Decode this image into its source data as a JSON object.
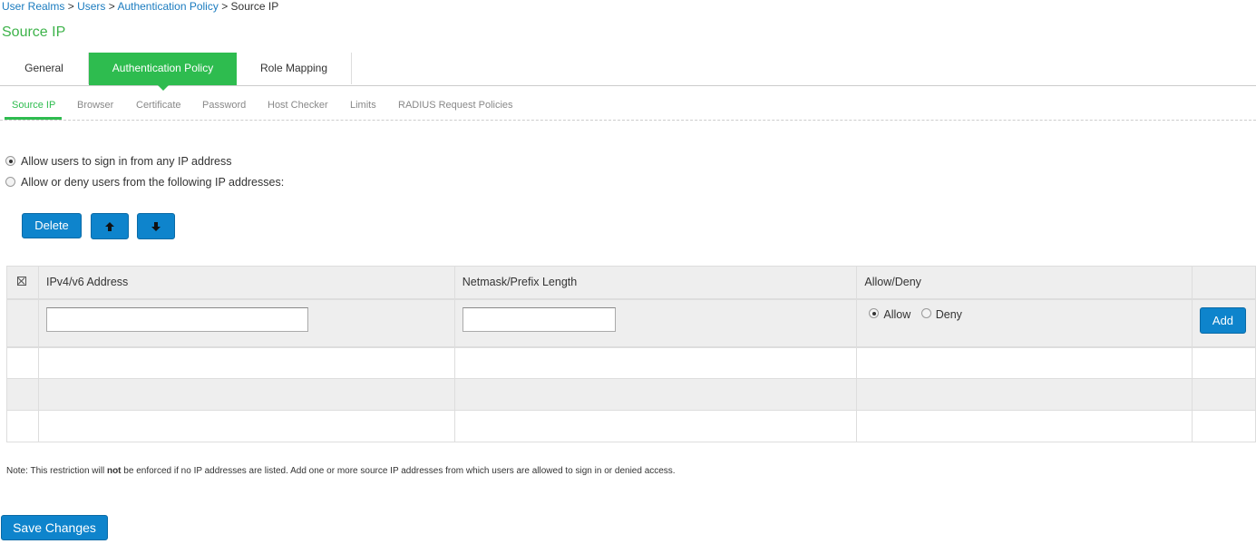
{
  "breadcrumb": {
    "items": [
      "User Realms",
      "Users",
      "Authentication Policy"
    ],
    "current": "Source IP",
    "separator": ">"
  },
  "page": {
    "title": "Source IP"
  },
  "main_tabs": [
    {
      "label": "General",
      "active": false
    },
    {
      "label": "Authentication Policy",
      "active": true
    },
    {
      "label": "Role Mapping",
      "active": false
    }
  ],
  "sub_tabs": [
    {
      "label": "Source IP",
      "active": true
    },
    {
      "label": "Browser",
      "active": false
    },
    {
      "label": "Certificate",
      "active": false
    },
    {
      "label": "Password",
      "active": false
    },
    {
      "label": "Host Checker",
      "active": false
    },
    {
      "label": "Limits",
      "active": false
    },
    {
      "label": "RADIUS Request Policies",
      "active": false
    }
  ],
  "options": {
    "any_ip": {
      "label": "Allow users to sign in from any IP address",
      "checked": true
    },
    "listed_ip": {
      "label": "Allow or deny users from the following IP addresses:",
      "checked": false
    }
  },
  "toolbar": {
    "delete_label": "Delete",
    "up_icon": "arrow-up-icon",
    "down_icon": "arrow-down-icon"
  },
  "table": {
    "columns": [
      "IPv4/v6 Address",
      "Netmask/Prefix Length",
      "Allow/Deny"
    ],
    "input_row": {
      "address_value": "",
      "netmask_value": "",
      "allow_label": "Allow",
      "deny_label": "Deny",
      "selected": "Allow",
      "add_label": "Add"
    },
    "rows": []
  },
  "note": {
    "prefix": "Note: This restriction will ",
    "bold": "not",
    "suffix": " be enforced if no IP addresses are listed. Add one or more source IP addresses from which users are allowed to sign in or denied access."
  },
  "footer": {
    "save_label": "Save Changes"
  },
  "colors": {
    "accent_green": "#2ebc4f",
    "button_blue": "#0e84cc",
    "link_blue": "#1a7bbf"
  }
}
